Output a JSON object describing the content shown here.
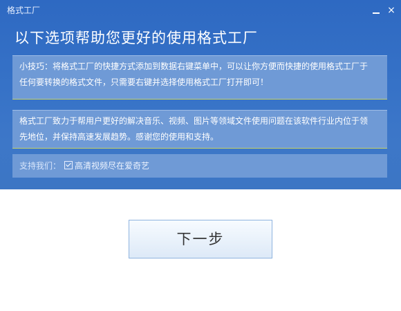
{
  "window": {
    "title": "格式工厂",
    "minimize_label": "",
    "close_label": "×"
  },
  "header": {
    "title": "以下选项帮助您更好的使用格式工厂"
  },
  "tip_panel": {
    "line1": "小技巧：将格式工厂的快捷方式添加到数据右键菜单中，可以让你方便而快捷的使用格式工厂于",
    "line2": "任何要转换的格式文件，只需要右键并选择使用格式工厂打开即可！"
  },
  "about_panel": {
    "line1": "格式工厂致力于帮用户更好的解决音乐、视频、图片等领域文件使用问题在该软件行业内位于领",
    "line2": "先地位，并保持高速发展趋势。感谢您的使用和支持。"
  },
  "support": {
    "label": "支持我们：",
    "checkbox_checked": true,
    "option_label": "高清视频尽在爱奇艺"
  },
  "actions": {
    "next_label": "下一步"
  },
  "colors": {
    "header_blue": "#3672c7",
    "panel_blue": "#6f9ad6",
    "button_border": "#8eb3df"
  }
}
